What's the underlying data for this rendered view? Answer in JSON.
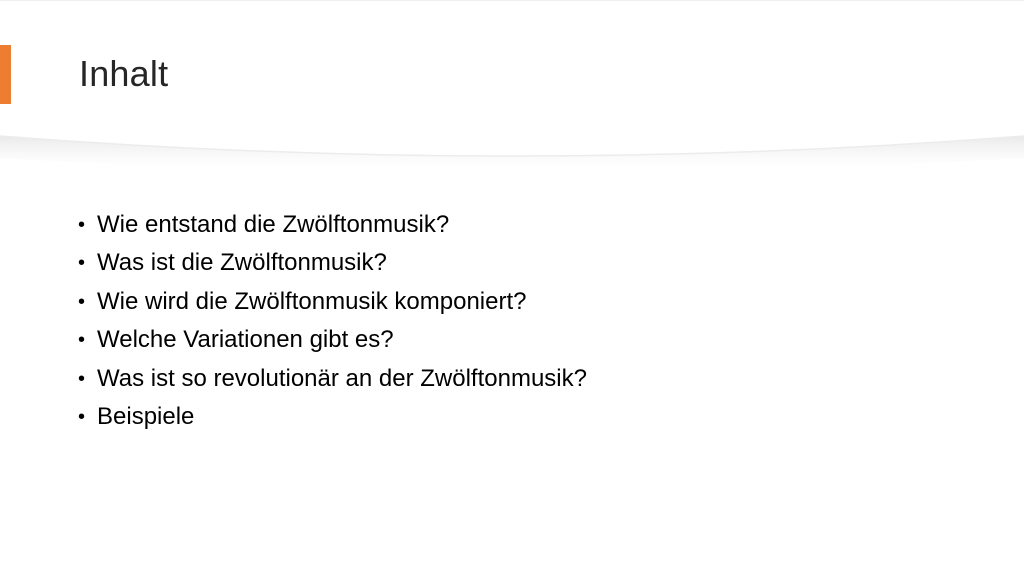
{
  "slide": {
    "title": "Inhalt",
    "accent_color": "#ED7D31",
    "bullet_symbol": "•",
    "bullets": [
      "Wie entstand die Zwölftonmusik?",
      "Was ist die Zwölftonmusik?",
      "Wie wird die Zwölftonmusik komponiert?",
      "Welche Variationen gibt es?",
      "Was ist so revolutionär an der Zwölftonmusik?",
      "Beispiele"
    ]
  }
}
